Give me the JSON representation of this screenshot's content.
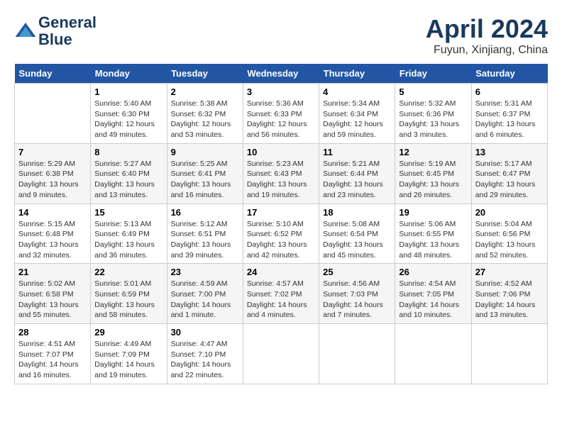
{
  "header": {
    "logo_line1": "General",
    "logo_line2": "Blue",
    "month": "April 2024",
    "location": "Fuyun, Xinjiang, China"
  },
  "weekdays": [
    "Sunday",
    "Monday",
    "Tuesday",
    "Wednesday",
    "Thursday",
    "Friday",
    "Saturday"
  ],
  "weeks": [
    [
      {
        "day": "",
        "info": ""
      },
      {
        "day": "1",
        "info": "Sunrise: 5:40 AM\nSunset: 6:30 PM\nDaylight: 12 hours\nand 49 minutes."
      },
      {
        "day": "2",
        "info": "Sunrise: 5:38 AM\nSunset: 6:32 PM\nDaylight: 12 hours\nand 53 minutes."
      },
      {
        "day": "3",
        "info": "Sunrise: 5:36 AM\nSunset: 6:33 PM\nDaylight: 12 hours\nand 56 minutes."
      },
      {
        "day": "4",
        "info": "Sunrise: 5:34 AM\nSunset: 6:34 PM\nDaylight: 12 hours\nand 59 minutes."
      },
      {
        "day": "5",
        "info": "Sunrise: 5:32 AM\nSunset: 6:36 PM\nDaylight: 13 hours\nand 3 minutes."
      },
      {
        "day": "6",
        "info": "Sunrise: 5:31 AM\nSunset: 6:37 PM\nDaylight: 13 hours\nand 6 minutes."
      }
    ],
    [
      {
        "day": "7",
        "info": "Sunrise: 5:29 AM\nSunset: 6:38 PM\nDaylight: 13 hours\nand 9 minutes."
      },
      {
        "day": "8",
        "info": "Sunrise: 5:27 AM\nSunset: 6:40 PM\nDaylight: 13 hours\nand 13 minutes."
      },
      {
        "day": "9",
        "info": "Sunrise: 5:25 AM\nSunset: 6:41 PM\nDaylight: 13 hours\nand 16 minutes."
      },
      {
        "day": "10",
        "info": "Sunrise: 5:23 AM\nSunset: 6:43 PM\nDaylight: 13 hours\nand 19 minutes."
      },
      {
        "day": "11",
        "info": "Sunrise: 5:21 AM\nSunset: 6:44 PM\nDaylight: 13 hours\nand 23 minutes."
      },
      {
        "day": "12",
        "info": "Sunrise: 5:19 AM\nSunset: 6:45 PM\nDaylight: 13 hours\nand 26 minutes."
      },
      {
        "day": "13",
        "info": "Sunrise: 5:17 AM\nSunset: 6:47 PM\nDaylight: 13 hours\nand 29 minutes."
      }
    ],
    [
      {
        "day": "14",
        "info": "Sunrise: 5:15 AM\nSunset: 6:48 PM\nDaylight: 13 hours\nand 32 minutes."
      },
      {
        "day": "15",
        "info": "Sunrise: 5:13 AM\nSunset: 6:49 PM\nDaylight: 13 hours\nand 36 minutes."
      },
      {
        "day": "16",
        "info": "Sunrise: 5:12 AM\nSunset: 6:51 PM\nDaylight: 13 hours\nand 39 minutes."
      },
      {
        "day": "17",
        "info": "Sunrise: 5:10 AM\nSunset: 6:52 PM\nDaylight: 13 hours\nand 42 minutes."
      },
      {
        "day": "18",
        "info": "Sunrise: 5:08 AM\nSunset: 6:54 PM\nDaylight: 13 hours\nand 45 minutes."
      },
      {
        "day": "19",
        "info": "Sunrise: 5:06 AM\nSunset: 6:55 PM\nDaylight: 13 hours\nand 48 minutes."
      },
      {
        "day": "20",
        "info": "Sunrise: 5:04 AM\nSunset: 6:56 PM\nDaylight: 13 hours\nand 52 minutes."
      }
    ],
    [
      {
        "day": "21",
        "info": "Sunrise: 5:02 AM\nSunset: 6:58 PM\nDaylight: 13 hours\nand 55 minutes."
      },
      {
        "day": "22",
        "info": "Sunrise: 5:01 AM\nSunset: 6:59 PM\nDaylight: 13 hours\nand 58 minutes."
      },
      {
        "day": "23",
        "info": "Sunrise: 4:59 AM\nSunset: 7:00 PM\nDaylight: 14 hours\nand 1 minute."
      },
      {
        "day": "24",
        "info": "Sunrise: 4:57 AM\nSunset: 7:02 PM\nDaylight: 14 hours\nand 4 minutes."
      },
      {
        "day": "25",
        "info": "Sunrise: 4:56 AM\nSunset: 7:03 PM\nDaylight: 14 hours\nand 7 minutes."
      },
      {
        "day": "26",
        "info": "Sunrise: 4:54 AM\nSunset: 7:05 PM\nDaylight: 14 hours\nand 10 minutes."
      },
      {
        "day": "27",
        "info": "Sunrise: 4:52 AM\nSunset: 7:06 PM\nDaylight: 14 hours\nand 13 minutes."
      }
    ],
    [
      {
        "day": "28",
        "info": "Sunrise: 4:51 AM\nSunset: 7:07 PM\nDaylight: 14 hours\nand 16 minutes."
      },
      {
        "day": "29",
        "info": "Sunrise: 4:49 AM\nSunset: 7:09 PM\nDaylight: 14 hours\nand 19 minutes."
      },
      {
        "day": "30",
        "info": "Sunrise: 4:47 AM\nSunset: 7:10 PM\nDaylight: 14 hours\nand 22 minutes."
      },
      {
        "day": "",
        "info": ""
      },
      {
        "day": "",
        "info": ""
      },
      {
        "day": "",
        "info": ""
      },
      {
        "day": "",
        "info": ""
      }
    ]
  ]
}
